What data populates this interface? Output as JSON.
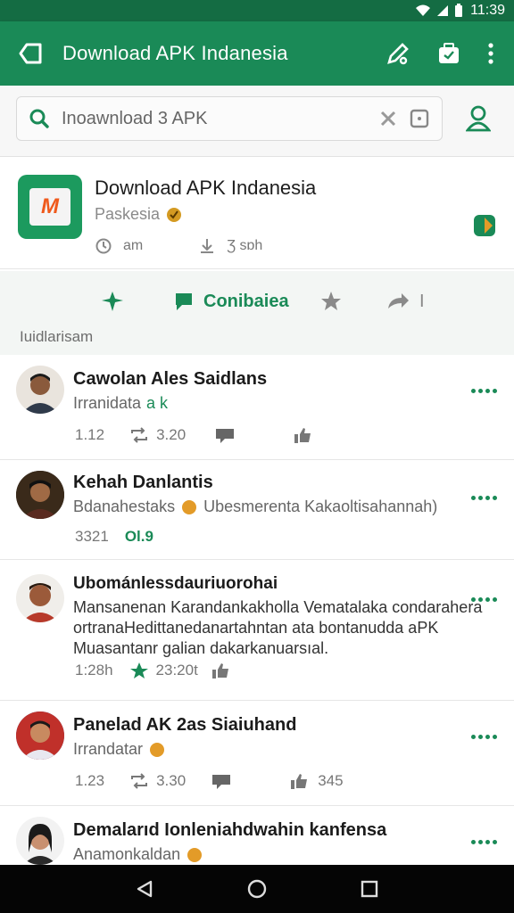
{
  "status_bar": {
    "time": "11:39"
  },
  "app_bar": {
    "title": "Download APK Indanesia"
  },
  "search": {
    "query": "Inoawnload 3 APK"
  },
  "app_card": {
    "name": "Download APK Indanesia",
    "subtitle": "Paskesia",
    "stat_1": "am",
    "stat_2": "Ʒ sɒh"
  },
  "tabs": {
    "active_label": "Conibaiea",
    "share_count": "I"
  },
  "section_label": "Iuidlarisam",
  "posts": [
    {
      "name": "Cawolan Ales Saidlans",
      "sub": "Irranidata",
      "sub_tag": "a k",
      "meta_1": "1.12",
      "meta_2": "3.20",
      "meta_3": ""
    },
    {
      "name": "Kehah Danlantis",
      "sub": "Bdanahestaks",
      "sub_2": "Ubesmerenta Kakaoltisahannah)",
      "meta_1": "3321",
      "meta_2": "Ol.9"
    },
    {
      "name": "Ubománlessdauriuorohai",
      "body": "Mansanenan Karandankakholla Vematalaka condarahera ortranaHedittanedanartahntan ata bontanudda aPK Muasantanr galian dakarkanuarsıal.",
      "meta_1": "1:28h",
      "meta_2": "23:20t"
    },
    {
      "name": "Panelad AK 2as Siaiuhand",
      "sub": "Irrandatar",
      "meta_1": "1.23",
      "meta_2": "3.30",
      "meta_3": "345"
    },
    {
      "name": "Demalarıd Ionleniahdwahin kanfensa",
      "sub": "Anamonkaldan"
    }
  ]
}
